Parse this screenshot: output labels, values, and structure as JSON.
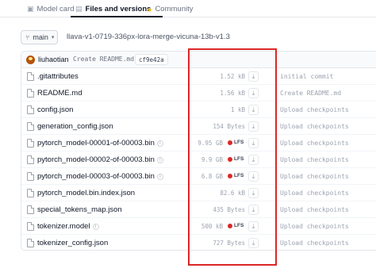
{
  "tabs": [
    {
      "label": "Model card",
      "icon": "card-icon"
    },
    {
      "label": "Files and versions",
      "icon": "files-icon",
      "active": true
    },
    {
      "label": "Community",
      "icon": "community-icon"
    }
  ],
  "branch": {
    "label": "main",
    "icon": "branch-icon"
  },
  "repo_path": "llava-v1-0719-336px-lora-merge-vicuna-13b-v1.3",
  "commit": {
    "author": "liuhaotian",
    "message": "Create README.md",
    "hash": "cf9e42a"
  },
  "lfs_label": "LFS",
  "files": [
    {
      "name": ".gitattributes",
      "size": "1.52 kB",
      "lfs": false,
      "commit_msg": "initial commit"
    },
    {
      "name": "README.md",
      "size": "1.56 kB",
      "lfs": false,
      "commit_msg": "Create README.md"
    },
    {
      "name": "config.json",
      "size": "1 kB",
      "lfs": false,
      "commit_msg": "Upload checkpoints"
    },
    {
      "name": "generation_config.json",
      "size": "154 Bytes",
      "lfs": false,
      "commit_msg": "Upload checkpoints"
    },
    {
      "name": "pytorch_model-00001-of-00003.bin",
      "size": "9.95 GB",
      "lfs": true,
      "commit_msg": "Upload checkpoints"
    },
    {
      "name": "pytorch_model-00002-of-00003.bin",
      "size": "9.9 GB",
      "lfs": true,
      "commit_msg": "Upload checkpoints"
    },
    {
      "name": "pytorch_model-00003-of-00003.bin",
      "size": "6.8 GB",
      "lfs": true,
      "commit_msg": "Upload checkpoints"
    },
    {
      "name": "pytorch_model.bin.index.json",
      "size": "82.6 kB",
      "lfs": false,
      "commit_msg": "Upload checkpoints"
    },
    {
      "name": "special_tokens_map.json",
      "size": "435 Bytes",
      "lfs": false,
      "commit_msg": "Upload checkpoints"
    },
    {
      "name": "tokenizer.model",
      "size": "500 kB",
      "lfs": true,
      "commit_msg": "Upload checkpoints"
    },
    {
      "name": "tokenizer_config.json",
      "size": "727 Bytes",
      "lfs": false,
      "commit_msg": "Upload checkpoints"
    }
  ],
  "colors": {
    "highlight": "#dc2626",
    "lfs_dot": "#dc2626"
  }
}
